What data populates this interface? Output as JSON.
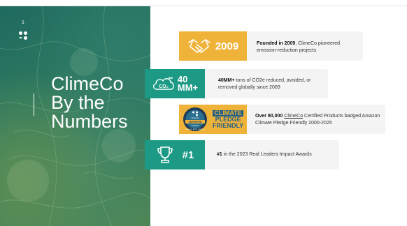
{
  "slide": {
    "number": "1"
  },
  "panel": {
    "title_lines": [
      "ClimeCo",
      "By the",
      "Numbers"
    ]
  },
  "stats": [
    {
      "badge_value": "2009",
      "desc_bold": "Founded in 2009",
      "desc_rest": ", ClimeCo pioneered emission-reduction projects"
    },
    {
      "badge_icon_text": "CO₂",
      "badge_value_line1": "40",
      "badge_value_line2": "MM+",
      "desc_bold": "40MM+",
      "desc_rest": " tons of CO2e reduced, avoided, or removed globally since 2009"
    },
    {
      "seal_top": "ClimeCo",
      "seal_mid": "CERTIFIED",
      "seal_sub": "Product",
      "seal_bottom": "REDUCE · AVOID · REMOVE",
      "climate_lines": [
        "CLIMATE",
        "PLEDGE",
        "FRIENDLY"
      ],
      "desc_bold": "Over 90,000",
      "desc_link": "ClimeCo",
      "desc_rest": " Certified Products badged Amazon Climate Pledge Friendly 2000-2025"
    },
    {
      "badge_value": "#1",
      "desc_bold": "#1",
      "desc_rest": " in the 2023 Real Leaders Impact Awards"
    }
  ],
  "colors": {
    "gold": "#f0b33a",
    "teal": "#1d9a85",
    "card": "#f4f4f4"
  },
  "icons": [
    "climeco-logo-icon",
    "handshake-icon",
    "cloud-co2-icon",
    "climeco-certified-seal-icon",
    "trophy-icon"
  ]
}
